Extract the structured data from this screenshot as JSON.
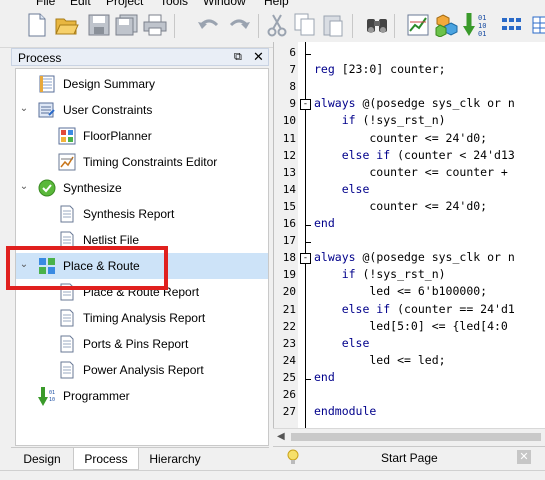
{
  "menu": [
    "File",
    "Edit",
    "Project",
    "Tools",
    "Window",
    "Help"
  ],
  "toolbar": {
    "icons": [
      "new-file-icon",
      "open-folder-icon",
      "save-icon",
      "save-all-icon",
      "print-icon",
      "undo-icon",
      "redo-icon",
      "cut-icon",
      "copy-icon",
      "paste-icon",
      "find-binoculars-icon",
      "timing-chart-icon",
      "cubes-icon",
      "bitstream-download-icon",
      "layout-grid-icon"
    ],
    "bitstream_text": [
      "01",
      "10",
      "01"
    ]
  },
  "process_panel": {
    "title": "Process",
    "tree": [
      {
        "label": "Design Summary",
        "icon": "summary-icon",
        "expanded": null
      },
      {
        "label": "User Constraints",
        "icon": "constraints-icon",
        "expanded": true
      },
      {
        "label": "FloorPlanner",
        "icon": "floorplanner-icon",
        "expanded": null
      },
      {
        "label": "Timing Constraints Editor",
        "icon": "timing-editor-icon",
        "expanded": null
      },
      {
        "label": "Synthesize",
        "icon": "check-circle-icon",
        "expanded": true
      },
      {
        "label": "Synthesis Report",
        "icon": "report-icon",
        "expanded": null
      },
      {
        "label": "Netlist File",
        "icon": "report-icon",
        "expanded": null
      },
      {
        "label": "Place & Route",
        "icon": "place-route-icon",
        "expanded": true
      },
      {
        "label": "Place & Route Report",
        "icon": "report-icon",
        "expanded": null
      },
      {
        "label": "Timing Analysis Report",
        "icon": "report-icon",
        "expanded": null
      },
      {
        "label": "Ports & Pins Report",
        "icon": "report-icon",
        "expanded": null
      },
      {
        "label": "Power Analysis Report",
        "icon": "report-icon",
        "expanded": null
      },
      {
        "label": "Programmer",
        "icon": "programmer-icon",
        "expanded": null
      }
    ],
    "selected_label": "Place & Route",
    "highlight_color": "#e0201e"
  },
  "bottom_tabs": [
    "Design",
    "Process",
    "Hierarchy"
  ],
  "active_bottom_tab": "Process",
  "editor": {
    "line_numbers": [
      "6",
      "7",
      "8",
      "9",
      "10",
      "11",
      "12",
      "13",
      "14",
      "15",
      "16",
      "17",
      "18",
      "19",
      "20",
      "21",
      "22",
      "23",
      "24",
      "25",
      "26",
      "27"
    ],
    "lines": [
      {
        "keyword": "",
        "text": ""
      },
      {
        "keyword": "reg",
        "text": " [23:0] counter;"
      },
      {
        "keyword": "",
        "text": ""
      },
      {
        "keyword": "always",
        "text": " @(posedge sys_clk or n"
      },
      {
        "keyword": "    if",
        "text": " (!sys_rst_n)"
      },
      {
        "keyword": "",
        "text": "        counter <= 24'd0;"
      },
      {
        "keyword": "    else if",
        "text": " (counter < 24'd13"
      },
      {
        "keyword": "",
        "text": "        counter <= counter +"
      },
      {
        "keyword": "    else",
        "text": ""
      },
      {
        "keyword": "",
        "text": "        counter <= 24'd0;"
      },
      {
        "keyword": "end",
        "text": ""
      },
      {
        "keyword": "",
        "text": ""
      },
      {
        "keyword": "always",
        "text": " @(posedge sys_clk or n"
      },
      {
        "keyword": "    if",
        "text": " (!sys_rst_n)"
      },
      {
        "keyword": "",
        "text": "        led <= 6'b100000;"
      },
      {
        "keyword": "    else if",
        "text": " (counter == 24'd1"
      },
      {
        "keyword": "",
        "text": "        led[5:0] <= {led[4:0"
      },
      {
        "keyword": "    else",
        "text": ""
      },
      {
        "keyword": "",
        "text": "        led <= led;"
      },
      {
        "keyword": "end",
        "text": ""
      },
      {
        "keyword": "",
        "text": ""
      },
      {
        "keyword": "endmodule",
        "text": ""
      }
    ],
    "fold_markers": [
      "-",
      "-"
    ]
  },
  "start_page": {
    "label": "Start Page",
    "close": "✕"
  },
  "panel_controls": {
    "float": "⧉",
    "close": "✕"
  }
}
